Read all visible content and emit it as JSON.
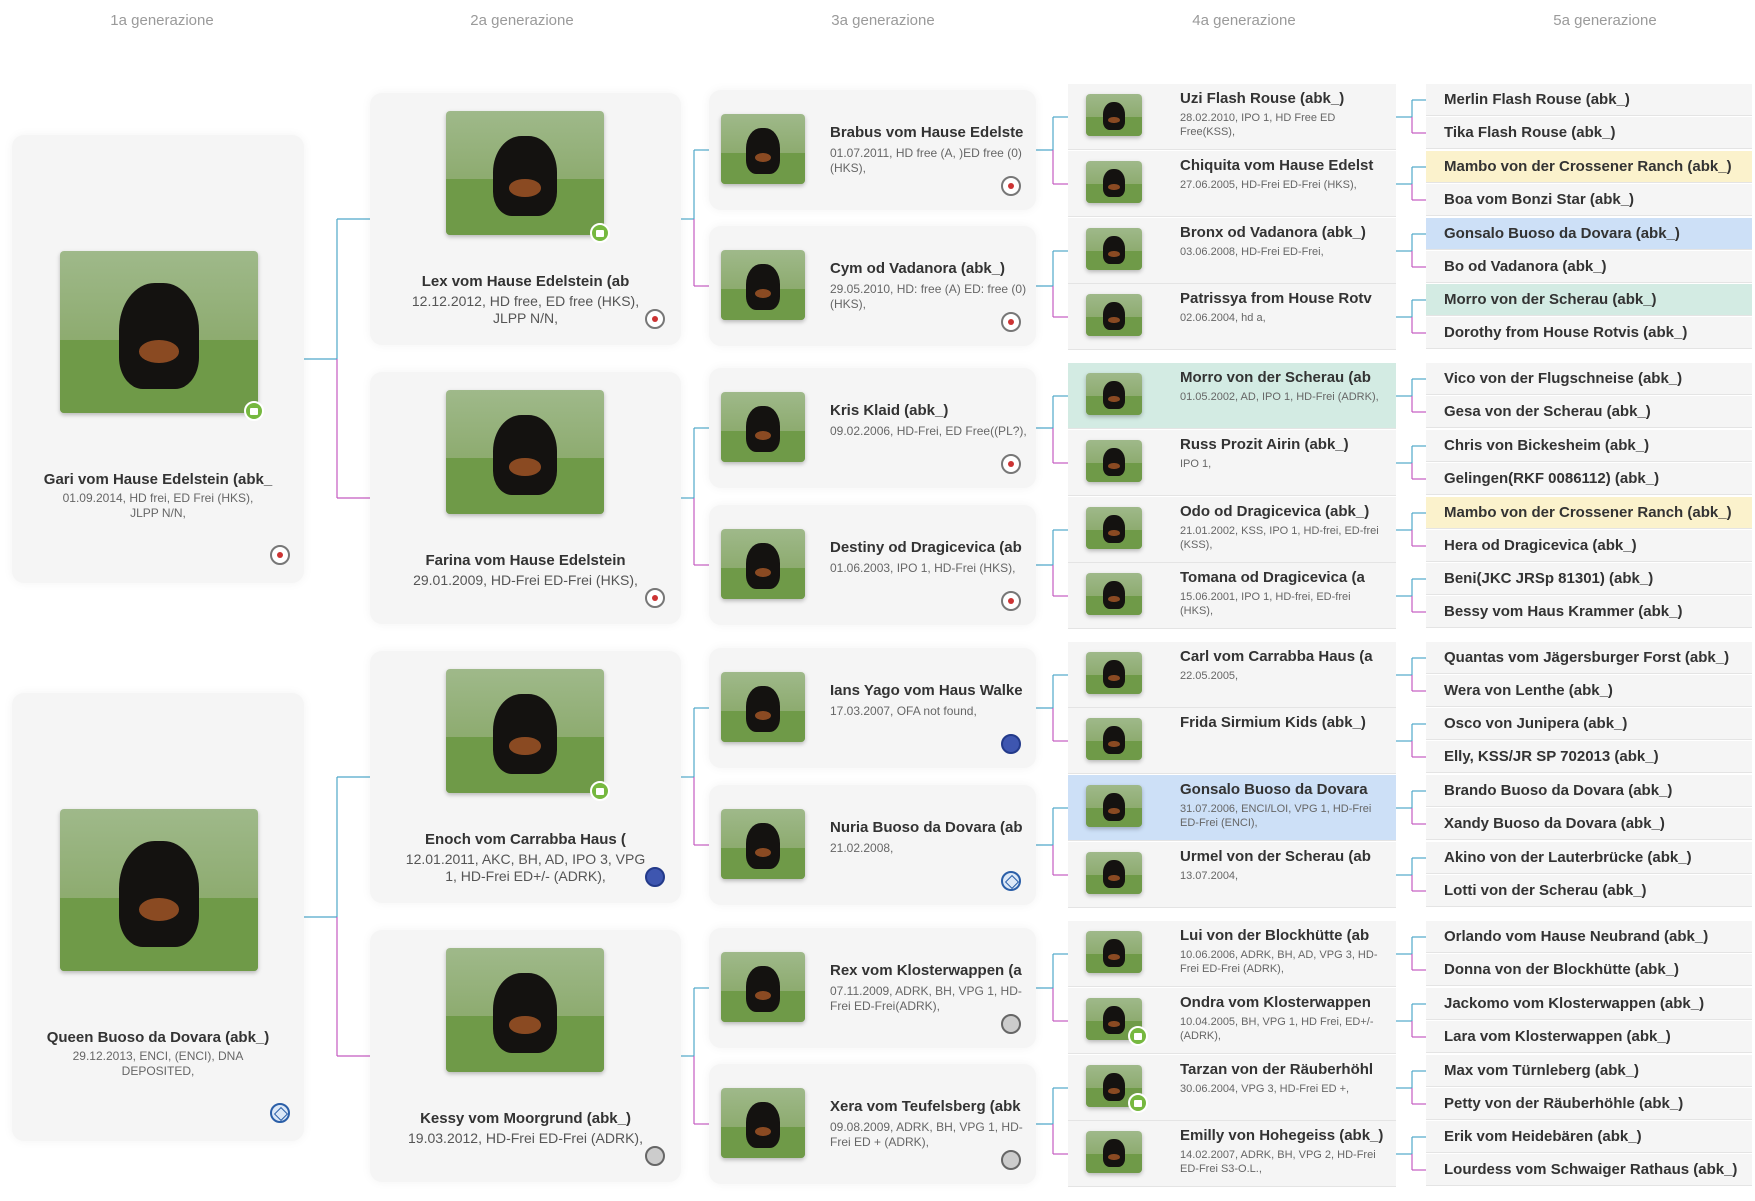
{
  "headers": [
    "1a generazione",
    "2a generazione",
    "3a generazione",
    "4a generazione",
    "5a generazione"
  ],
  "highlight_colors": {
    "yellow": "#fbf2cc",
    "blue": "#cde0f7",
    "teal": "#d3ebe3"
  },
  "line_colors": {
    "sire": "#4fa8c9",
    "dam": "#c45bc0"
  },
  "gen1": [
    {
      "name": "Gari vom Hause Edelstein (abk_",
      "details": "01.09.2014, HD frei, ED Frei (HKS), JLPP N/N,",
      "club": "vdh",
      "video": true
    },
    {
      "name": "Queen Buoso da Dovara (abk_)",
      "details": "29.12.2013, ENCI, (ENCI), DNA DEPOSITED,",
      "club": "enci",
      "video": false
    }
  ],
  "gen2": [
    {
      "name": "Lex vom Hause Edelstein (ab",
      "details": "12.12.2012, HD free, ED free (HKS), JLPP N/N,",
      "club": "vdh",
      "video": true
    },
    {
      "name": "Farina vom Hause Edelstein",
      "details": "29.01.2009, HD-Frei ED-Frei (HKS),",
      "club": "vdh",
      "video": false
    },
    {
      "name": "Enoch vom Carrabba Haus (",
      "details": "12.01.2011, AKC, BH, AD, IPO 3, VPG 1, HD-Frei ED+/- (ADRK),",
      "club": "ofa",
      "video": true
    },
    {
      "name": "Kessy vom Moorgrund (abk_)",
      "details": "19.03.2012, HD-Frei ED-Frei (ADRK),",
      "club": "adrk",
      "video": false
    }
  ],
  "gen3": [
    {
      "name": "Brabus vom Hause Edelste",
      "details": "01.07.2011, HD free (A, )ED free (0) (HKS),",
      "club": "vdh"
    },
    {
      "name": "Cym od Vadanora (abk_)",
      "details": "29.05.2010, HD: free (A) ED: free (0) (HKS),",
      "club": "vdh"
    },
    {
      "name": "Kris Klaid (abk_)",
      "details": "09.02.2006, HD-Frei, ED Free((PL?),",
      "club": "vdh"
    },
    {
      "name": "Destiny od Dragicevica (ab",
      "details": "01.06.2003, IPO 1, HD-Frei (HKS),",
      "club": "vdh"
    },
    {
      "name": "Ians Yago vom Haus Walke",
      "details": "17.03.2007, OFA not found,",
      "club": "ofa"
    },
    {
      "name": "Nuria Buoso da Dovara (ab",
      "details": "21.02.2008,",
      "club": "enci"
    },
    {
      "name": "Rex vom Klosterwappen (a",
      "details": "07.11.2009, ADRK, BH, VPG 1, HD-Frei ED-Frei(ADRK),",
      "club": "adrk"
    },
    {
      "name": "Xera vom Teufelsberg (abk",
      "details": "09.08.2009, ADRK, BH, VPG 1, HD-Frei ED + (ADRK),",
      "club": "adrk"
    }
  ],
  "gen4": [
    {
      "name": "Uzi Flash Rouse (abk_)",
      "details": "28.02.2010, IPO 1, HD Free ED Free(KSS),",
      "hl": "",
      "video": false
    },
    {
      "name": "Chiquita vom Hause Edelst",
      "details": "27.06.2005, HD-Frei ED-Frei (HKS),",
      "hl": "",
      "video": false
    },
    {
      "name": "Bronx od Vadanora (abk_)",
      "details": "03.06.2008, HD-Frei ED-Frei,",
      "hl": "",
      "video": false
    },
    {
      "name": "Patrissya from House Rotv",
      "details": "02.06.2004, hd a,",
      "hl": "",
      "video": false
    },
    {
      "name": "Morro von der Scherau (ab",
      "details": "01.05.2002, AD, IPO 1, HD-Frei (ADRK),",
      "hl": "teal",
      "video": false
    },
    {
      "name": "Russ Prozit Airin (abk_)",
      "details": "IPO 1,",
      "hl": "",
      "video": false
    },
    {
      "name": "Odo od Dragicevica (abk_)",
      "details": "21.01.2002, KSS, IPO 1, HD-frei, ED-frei (KSS),",
      "hl": "",
      "video": false
    },
    {
      "name": "Tomana od Dragicevica (a",
      "details": "15.06.2001, IPO 1, HD-frei, ED-frei (HKS),",
      "hl": "",
      "video": false
    },
    {
      "name": "Carl vom Carrabba Haus (a",
      "details": "22.05.2005,",
      "hl": "",
      "video": false
    },
    {
      "name": "Frida Sirmium Kids (abk_)",
      "details": "",
      "hl": "",
      "video": false
    },
    {
      "name": "Gonsalo Buoso da Dovara",
      "details": "31.07.2006, ENCI/LOI, VPG 1, HD-Frei ED-Frei (ENCI),",
      "hl": "blue",
      "video": false
    },
    {
      "name": "Urmel von der Scherau (ab",
      "details": "13.07.2004,",
      "hl": "",
      "video": false
    },
    {
      "name": "Lui von der Blockhütte (ab",
      "details": "10.06.2006, ADRK, BH, AD, VPG 3, HD-Frei ED-Frei (ADRK),",
      "hl": "",
      "video": false
    },
    {
      "name": "Ondra vom Klosterwappen",
      "details": "10.04.2005, BH, VPG 1, HD Frei, ED+/- (ADRK),",
      "hl": "",
      "video": true
    },
    {
      "name": "Tarzan von der Räuberhöhl",
      "details": "30.06.2004, VPG 3, HD-Frei ED +,",
      "hl": "",
      "video": true
    },
    {
      "name": "Emilly von Hohegeiss (abk_)",
      "details": "14.02.2007, ADRK, BH, VPG 2, HD-Frei ED-Frei S3-O.L.,",
      "hl": "",
      "video": false
    }
  ],
  "gen5": [
    {
      "name": "Merlin Flash Rouse (abk_)",
      "hl": ""
    },
    {
      "name": "Tika Flash Rouse (abk_)",
      "hl": ""
    },
    {
      "name": "Mambo von der Crossener Ranch (abk_)",
      "hl": "yellow"
    },
    {
      "name": "Boa vom Bonzi Star (abk_)",
      "hl": ""
    },
    {
      "name": "Gonsalo Buoso da Dovara (abk_)",
      "hl": "blue"
    },
    {
      "name": "Bo od Vadanora (abk_)",
      "hl": ""
    },
    {
      "name": "Morro von der Scherau (abk_)",
      "hl": "teal"
    },
    {
      "name": "Dorothy from House Rotvis (abk_)",
      "hl": ""
    },
    {
      "name": "Vico von der Flugschneise (abk_)",
      "hl": ""
    },
    {
      "name": "Gesa von der Scherau (abk_)",
      "hl": ""
    },
    {
      "name": "Chris von Bickesheim (abk_)",
      "hl": ""
    },
    {
      "name": "Gelingen(RKF 0086112) (abk_)",
      "hl": ""
    },
    {
      "name": "Mambo von der Crossener Ranch (abk_)",
      "hl": "yellow"
    },
    {
      "name": "Hera od Dragicevica (abk_)",
      "hl": ""
    },
    {
      "name": "Beni(JKC JRSp 81301) (abk_)",
      "hl": ""
    },
    {
      "name": "Bessy vom Haus Krammer (abk_)",
      "hl": ""
    },
    {
      "name": "Quantas vom Jägersburger Forst (abk_)",
      "hl": ""
    },
    {
      "name": "Wera von Lenthe (abk_)",
      "hl": ""
    },
    {
      "name": "Osco von Junipera (abk_)",
      "hl": ""
    },
    {
      "name": "Elly, KSS/JR SP 702013 (abk_)",
      "hl": ""
    },
    {
      "name": "Brando Buoso da Dovara (abk_)",
      "hl": ""
    },
    {
      "name": "Xandy Buoso da Dovara (abk_)",
      "hl": ""
    },
    {
      "name": "Akino von der Lauterbrücke (abk_)",
      "hl": ""
    },
    {
      "name": "Lotti von der Scherau (abk_)",
      "hl": ""
    },
    {
      "name": "Orlando vom Hause Neubrand (abk_)",
      "hl": ""
    },
    {
      "name": "Donna von der Blockhütte (abk_)",
      "hl": ""
    },
    {
      "name": "Jackomo vom Klosterwappen (abk_)",
      "hl": ""
    },
    {
      "name": "Lara vom Klosterwappen (abk_)",
      "hl": ""
    },
    {
      "name": "Max vom Türnleberg (abk_)",
      "hl": ""
    },
    {
      "name": "Petty von der Räuberhöhle (abk_)",
      "hl": ""
    },
    {
      "name": "Erik vom Heidebären (abk_)",
      "hl": ""
    },
    {
      "name": "Lourdess vom Schwaiger Rathaus (abk_)",
      "hl": ""
    }
  ]
}
